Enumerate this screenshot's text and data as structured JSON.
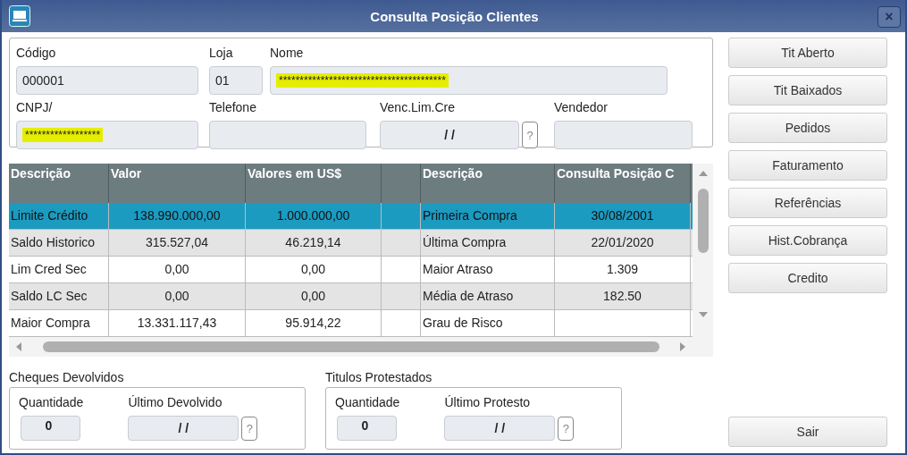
{
  "window": {
    "title": "Consulta Posição Clientes",
    "close": "×"
  },
  "client": {
    "rows": [
      [
        {
          "label": "Código",
          "value": "000001",
          "highlighted": false
        },
        {
          "label": "Loja",
          "value": "01",
          "highlighted": false
        },
        {
          "label": "Nome",
          "value": "****************************************",
          "highlighted": true
        }
      ],
      [
        {
          "label": "CNPJ/",
          "value": "******************",
          "highlighted": true
        },
        {
          "label": "Telefone"
        },
        {
          "label": "Venc.Lim.Cre",
          "value": "/ /",
          "help": "?",
          "highlighted": false
        },
        {
          "label": "Vendedor"
        }
      ]
    ]
  },
  "table": {
    "columns": [
      {
        "label": "Descrição"
      },
      {
        "label": "Valor"
      },
      {
        "label": "Valores em US$"
      },
      {
        "label": "Descrição"
      },
      {
        "label": "Consulta Posição C"
      }
    ],
    "rows": [
      {
        "selected": true,
        "cells": [
          "Limite Crédito",
          "138.990.000,00",
          "1.000.000,00",
          "Primeira Compra",
          "30/08/2001"
        ]
      },
      {
        "selected": false,
        "cells": [
          "Saldo Historico",
          "315.527,04",
          "46.219,14",
          "Última Compra",
          "22/01/2020"
        ]
      },
      {
        "selected": false,
        "cells": [
          "Lim Cred Sec",
          "0,00",
          "0,00",
          "Maior Atraso",
          "1.309"
        ]
      },
      {
        "selected": false,
        "cells": [
          "Saldo LC Sec",
          "0,00",
          "0,00",
          "Média de Atraso",
          "182.50"
        ]
      },
      {
        "selected": false,
        "cells": [
          "Maior Compra",
          "13.331.117,43",
          "95.914,22",
          "Grau de Risco",
          null
        ]
      }
    ]
  },
  "groups": [
    {
      "title": "Cheques Devolvidos",
      "quantity": {
        "label": "Quantidade",
        "value": "0"
      },
      "last": {
        "label": "Último Devolvido",
        "value": "/ /",
        "help": "?"
      }
    },
    {
      "title": "Titulos Protestados",
      "quantity": {
        "label": "Quantidade",
        "value": "0"
      },
      "last": {
        "label": "Último Protesto",
        "value": "/ /",
        "help": "?"
      }
    }
  ],
  "buttons": [
    "Tit Aberto",
    "Tit Baixados",
    "Pedidos",
    "Faturamento",
    "Referências",
    "Hist.Cobrança",
    "Credito"
  ],
  "exit_button": "Sair"
}
